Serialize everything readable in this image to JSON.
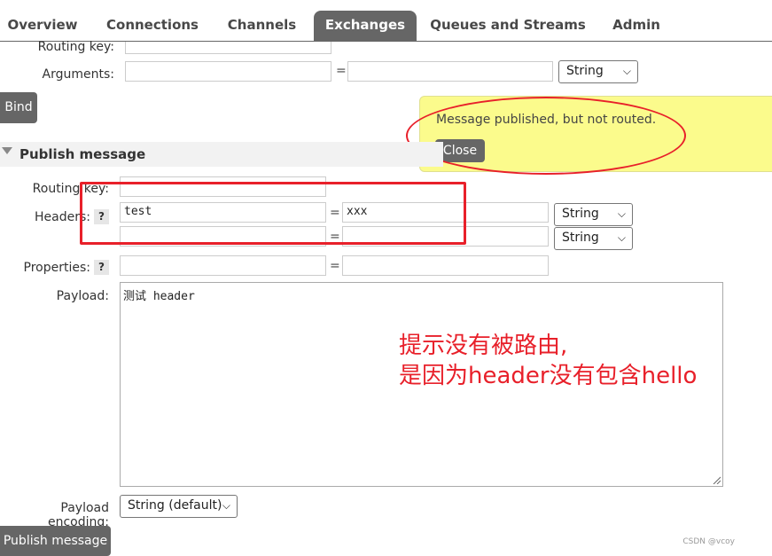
{
  "nav": {
    "tabs": [
      {
        "label": "Overview",
        "active": false
      },
      {
        "label": "Connections",
        "active": false
      },
      {
        "label": "Channels",
        "active": false
      },
      {
        "label": "Exchanges",
        "active": true
      },
      {
        "label": "Queues and Streams",
        "active": false
      },
      {
        "label": "Admin",
        "active": false
      }
    ]
  },
  "bind_form": {
    "routing_key_label": "Routing key:",
    "arguments_label": "Arguments:",
    "equals": "=",
    "arg_type": "String",
    "bind_button": "Bind"
  },
  "notice": {
    "message": "Message published, but not routed.",
    "close_button": "Close",
    "color": "#fbfb8c"
  },
  "publish": {
    "section_title": "Publish message",
    "routing_key_label": "Routing key:",
    "headers_label": "Headers:",
    "help": "?",
    "headers": [
      {
        "key": "test",
        "value": "xxx",
        "type": "String"
      },
      {
        "key": "",
        "value": "",
        "type": "String"
      }
    ],
    "properties_label": "Properties:",
    "payload_label": "Payload:",
    "payload_value": "测试 header",
    "payload_encoding_label": "Payload encoding:",
    "payload_encoding_value": "String (default)",
    "publish_button": "Publish message"
  },
  "annotation": {
    "line1": "提示没有被路由,",
    "line2": "是因为header没有包含hello",
    "color": "#e8202a"
  },
  "watermark": "CSDN @vcoy"
}
